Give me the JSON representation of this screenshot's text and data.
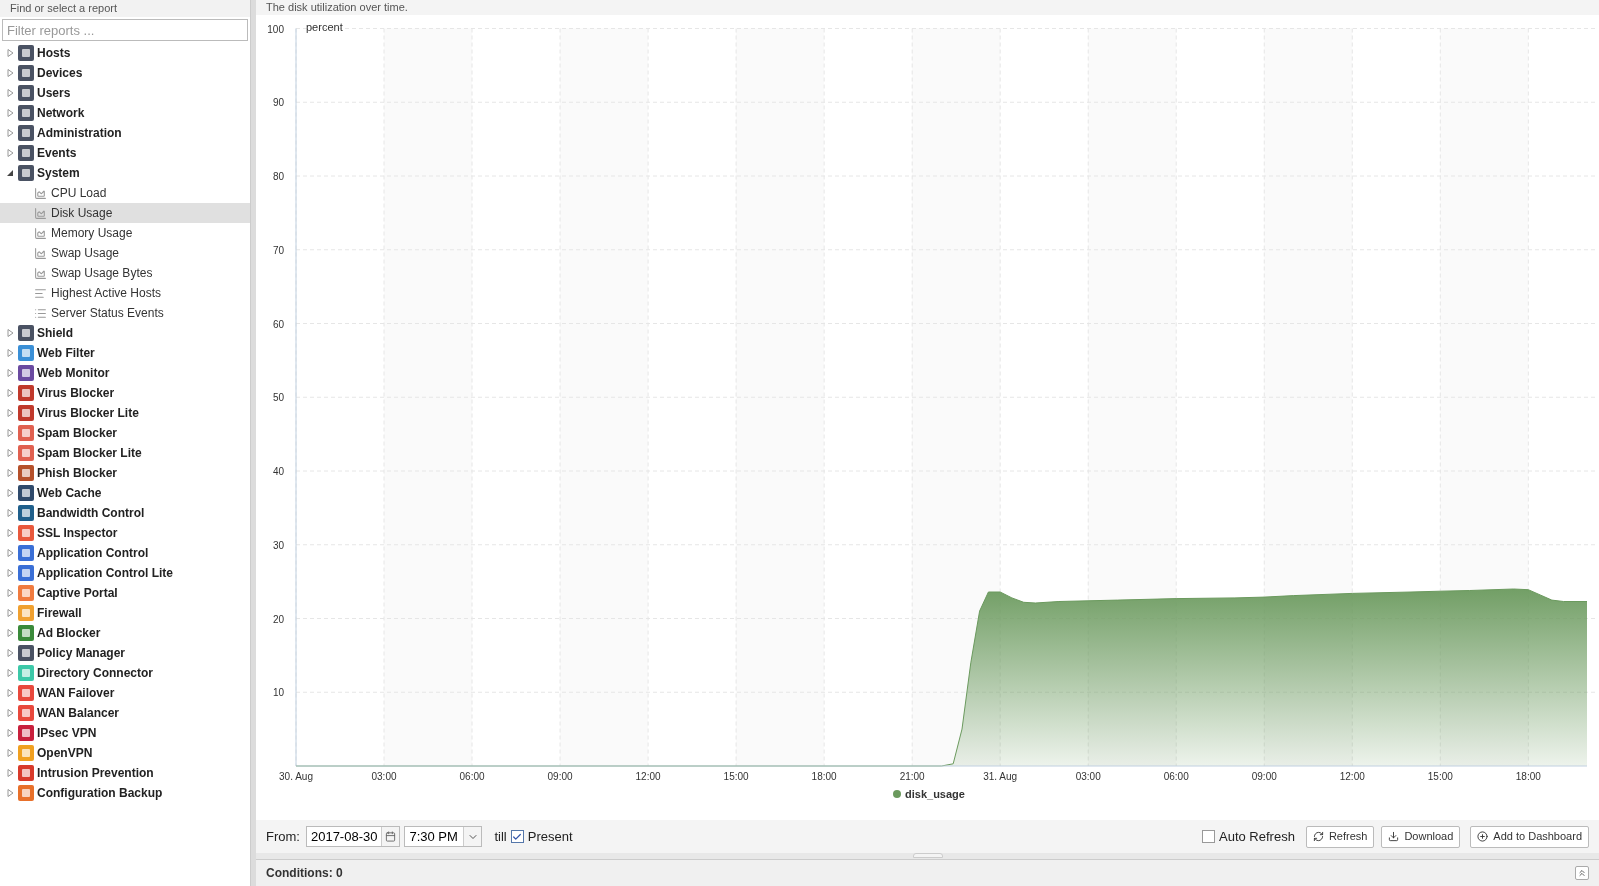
{
  "sidebar": {
    "title": "Find or select a report",
    "filter": {
      "placeholder": "Filter reports ..."
    },
    "items": [
      {
        "label": "Hosts",
        "expanded": false
      },
      {
        "label": "Devices",
        "expanded": false
      },
      {
        "label": "Users",
        "expanded": false
      },
      {
        "label": "Network",
        "expanded": false
      },
      {
        "label": "Administration",
        "expanded": false
      },
      {
        "label": "Events",
        "expanded": false
      },
      {
        "label": "System",
        "expanded": true,
        "children": [
          {
            "label": "CPU Load",
            "kind": "chart",
            "selected": false
          },
          {
            "label": "Disk Usage",
            "kind": "chart",
            "selected": true
          },
          {
            "label": "Memory Usage",
            "kind": "chart",
            "selected": false
          },
          {
            "label": "Swap Usage",
            "kind": "chart",
            "selected": false
          },
          {
            "label": "Swap Usage Bytes",
            "kind": "chart",
            "selected": false
          },
          {
            "label": "Highest Active Hosts",
            "kind": "text",
            "selected": false
          },
          {
            "label": "Server Status Events",
            "kind": "events",
            "selected": false
          }
        ]
      },
      {
        "label": "Shield",
        "expanded": false
      },
      {
        "label": "Web Filter",
        "expanded": false
      },
      {
        "label": "Web Monitor",
        "expanded": false
      },
      {
        "label": "Virus Blocker",
        "expanded": false
      },
      {
        "label": "Virus Blocker Lite",
        "expanded": false
      },
      {
        "label": "Spam Blocker",
        "expanded": false
      },
      {
        "label": "Spam Blocker Lite",
        "expanded": false
      },
      {
        "label": "Phish Blocker",
        "expanded": false
      },
      {
        "label": "Web Cache",
        "expanded": false
      },
      {
        "label": "Bandwidth Control",
        "expanded": false
      },
      {
        "label": "SSL Inspector",
        "expanded": false
      },
      {
        "label": "Application Control",
        "expanded": false
      },
      {
        "label": "Application Control Lite",
        "expanded": false
      },
      {
        "label": "Captive Portal",
        "expanded": false
      },
      {
        "label": "Firewall",
        "expanded": false
      },
      {
        "label": "Ad Blocker",
        "expanded": false
      },
      {
        "label": "Policy Manager",
        "expanded": false
      },
      {
        "label": "Directory Connector",
        "expanded": false
      },
      {
        "label": "WAN Failover",
        "expanded": false
      },
      {
        "label": "WAN Balancer",
        "expanded": false
      },
      {
        "label": "IPsec VPN",
        "expanded": false
      },
      {
        "label": "OpenVPN",
        "expanded": false
      },
      {
        "label": "Intrusion Prevention",
        "expanded": false
      },
      {
        "label": "Configuration Backup",
        "expanded": false
      }
    ]
  },
  "report": {
    "description": "The disk utilization over time.",
    "chart_data": {
      "type": "area",
      "ylabel": "percent",
      "ylim": [
        0,
        100
      ],
      "xlim": [
        "2017-08-30 00:00",
        "2017-08-31 20:00"
      ],
      "grid": true,
      "x": [
        "2017-08-30 00:00",
        "2017-08-30 22:00",
        "2017-08-30 22:24",
        "2017-08-30 22:42",
        "2017-08-30 23:00",
        "2017-08-30 23:18",
        "2017-08-30 23:36",
        "2017-08-31 00:00",
        "2017-08-31 00:24",
        "2017-08-31 00:48",
        "2017-08-31 01:12",
        "2017-08-31 02:00",
        "2017-08-31 04:00",
        "2017-08-31 06:00",
        "2017-08-31 08:00",
        "2017-08-31 09:00",
        "2017-08-31 10:00",
        "2017-08-31 12:00",
        "2017-08-31 14:00",
        "2017-08-31 15:00",
        "2017-08-31 16:00",
        "2017-08-31 17:30",
        "2017-08-31 18:00",
        "2017-08-31 18:24",
        "2017-08-31 18:48",
        "2017-08-31 19:12",
        "2017-08-31 20:00"
      ],
      "series": [
        {
          "name": "disk_usage",
          "color": "#6b9a5e",
          "values": [
            0,
            0,
            0.3,
            5,
            14,
            21,
            23.6,
            23.6,
            22.8,
            22.2,
            22.1,
            22.3,
            22.5,
            22.7,
            22.8,
            22.9,
            23.1,
            23.4,
            23.6,
            23.7,
            23.8,
            24,
            23.9,
            23.2,
            22.5,
            22.3,
            22.3
          ]
        }
      ],
      "yticks": [
        10,
        20,
        30,
        40,
        50,
        60,
        70,
        80,
        90,
        100
      ],
      "xticks": [
        {
          "value": "2017-08-30 00:00",
          "label": "30. Aug"
        },
        {
          "value": "2017-08-30 03:00",
          "label": "03:00"
        },
        {
          "value": "2017-08-30 06:00",
          "label": "06:00"
        },
        {
          "value": "2017-08-30 09:00",
          "label": "09:00"
        },
        {
          "value": "2017-08-30 12:00",
          "label": "12:00"
        },
        {
          "value": "2017-08-30 15:00",
          "label": "15:00"
        },
        {
          "value": "2017-08-30 18:00",
          "label": "18:00"
        },
        {
          "value": "2017-08-30 21:00",
          "label": "21:00"
        },
        {
          "value": "2017-08-31 00:00",
          "label": "31. Aug"
        },
        {
          "value": "2017-08-31 03:00",
          "label": "03:00"
        },
        {
          "value": "2017-08-31 06:00",
          "label": "06:00"
        },
        {
          "value": "2017-08-31 09:00",
          "label": "09:00"
        },
        {
          "value": "2017-08-31 12:00",
          "label": "12:00"
        },
        {
          "value": "2017-08-31 15:00",
          "label": "15:00"
        },
        {
          "value": "2017-08-31 18:00",
          "label": "18:00"
        }
      ]
    }
  },
  "toolbar": {
    "from_label": "From:",
    "date": "2017-08-30",
    "time": "7:30 PM",
    "till_label": "till",
    "present": {
      "label": "Present",
      "checked": true
    },
    "auto_refresh": {
      "label": "Auto Refresh",
      "checked": false
    },
    "buttons": [
      "Refresh",
      "Download",
      "Add to Dashboard"
    ]
  },
  "conditions": {
    "label": "Conditions: 0"
  }
}
